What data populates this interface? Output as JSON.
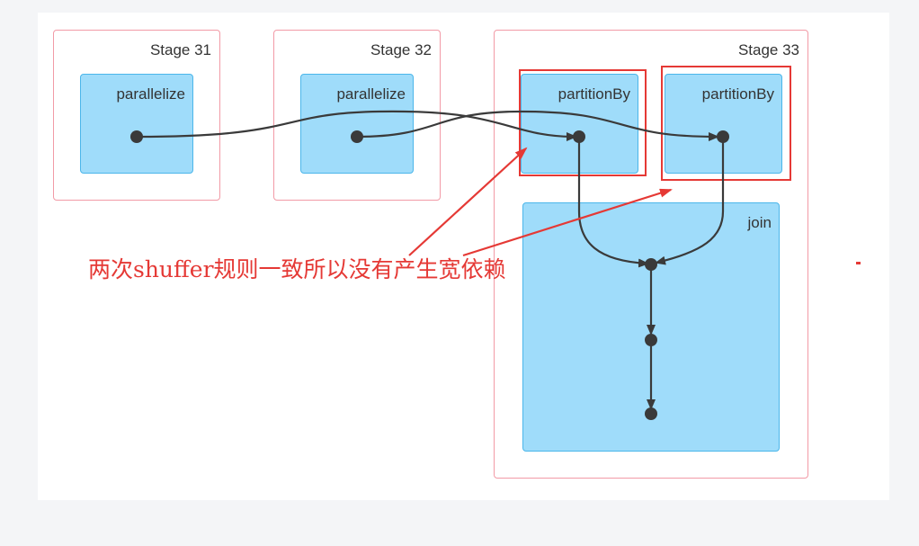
{
  "stages": [
    {
      "label": "Stage 31",
      "ops": [
        {
          "label": "parallelize"
        }
      ]
    },
    {
      "label": "Stage 32",
      "ops": [
        {
          "label": "parallelize"
        }
      ]
    },
    {
      "label": "Stage 33",
      "ops": [
        {
          "label": "partitionBy"
        },
        {
          "label": "partitionBy"
        },
        {
          "label": "join"
        }
      ]
    }
  ],
  "annotation": "两次shuffer规则一致所以没有产生宽依赖",
  "colors": {
    "stage_border": "#f29aa6",
    "op_fill": "#9fdcfa",
    "op_border": "#4bb6ea",
    "highlight": "#e53935",
    "edge": "#3a3a3a",
    "node": "#3a3a3a"
  }
}
